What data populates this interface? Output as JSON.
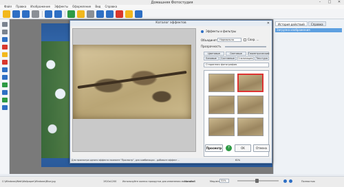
{
  "app": {
    "title": "Домашняя Фотостудия"
  },
  "window_controls": {
    "minimize": "–",
    "maximize": "□",
    "close": "✕"
  },
  "menu": [
    "Файл",
    "Правка",
    "Изображение",
    "Эффекты",
    "Оформление",
    "Вид",
    "Справка"
  ],
  "toolbar": {
    "icons": [
      "open-icon",
      "save-icon",
      "save-as-icon",
      "print-icon",
      "undo-icon",
      "redo-icon",
      "text-icon",
      "image-icon",
      "frame-icon",
      "collage-icon",
      "filmstrip-icon",
      "calendar-icon",
      "mail-icon",
      "exit-icon"
    ],
    "colors": {
      "blue": "#2e6fc4",
      "yellow": "#f2b81d",
      "green": "#2e9a44",
      "red": "#d9372c",
      "gray": "#8a8f96"
    }
  },
  "right_panel": {
    "tabs": [
      "История действий",
      "Справка"
    ],
    "history": [
      "Загрузка изображения"
    ]
  },
  "dialog": {
    "title": "Каталог эффектов",
    "close": "✕",
    "radio_effects": "Эффекты и фильтры",
    "blend_label": "Объединять",
    "blend_value": "Нормально",
    "blend_check": "Сохр. ...",
    "opacity_label": "Прозрачность",
    "tabs_row1": [
      "Цветовые",
      "Световые",
      "Геометрические"
    ],
    "tabs_row2": [
      "Базовые",
      "Составные",
      "Стилизация",
      "Текстура"
    ],
    "filter_value": "Старинная фотография",
    "thumbs": 6,
    "selected_thumb": 1,
    "buttons": {
      "preview": "Просмотр",
      "help": "?",
      "ok": "OK",
      "cancel": "Отмена"
    },
    "status": "Для просмотра одного эффекта нажмите \"Просмотр\", для комбинации - добавьте эффект ...",
    "status_right": "61%"
  },
  "statusbar": {
    "path": "C:\\Windows\\Web\\Wallpaper\\Windows\\Blue.jpg",
    "size": "1920x1200",
    "hint": "Используйте колесо прокрутки для изменения масштаба",
    "zoom_label": "Масштаб",
    "zoom_value": "31%",
    "colors_label": "Медленно",
    "fit_label": "Полностью"
  }
}
